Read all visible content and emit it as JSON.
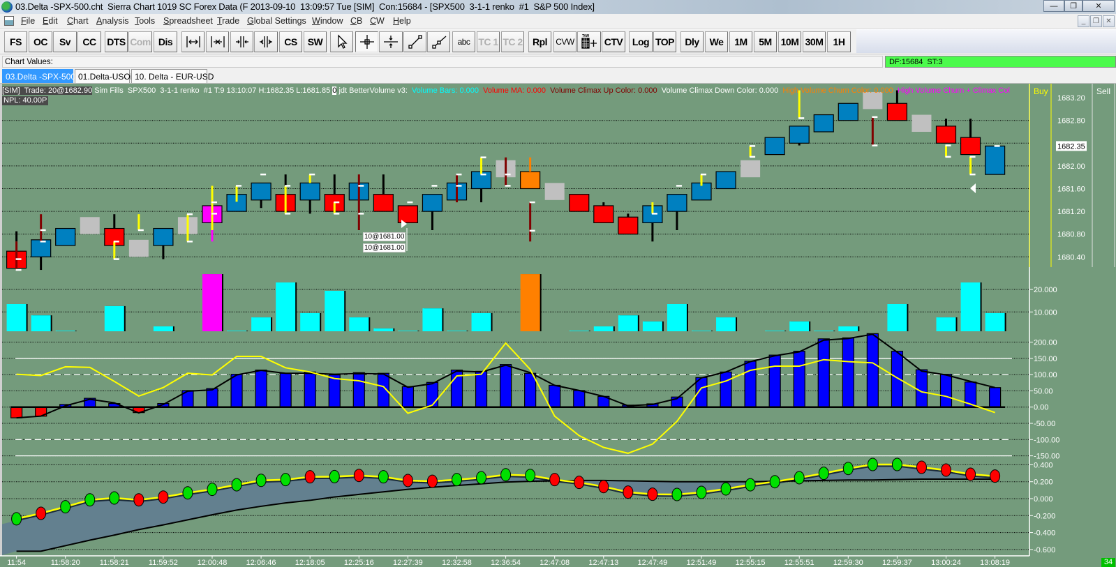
{
  "window": {
    "title": "03.Delta -SPX-500.cht  Sierra Chart 1019 SC Forex Data (F 2013-09-10  13:09:57 Tue [SIM]  Con:15684 - [SPX500  3-1-1 renko  #1  S&P 500 Index]",
    "controls": [
      "—",
      "❐",
      "✕"
    ],
    "mdi_controls": [
      "_",
      "❐",
      "✕"
    ]
  },
  "menu": [
    "File",
    "Edit",
    "Chart",
    "Analysis",
    "Tools",
    "Spreadsheet",
    "Trade",
    "Global Settings",
    "Window",
    "CB",
    "CW",
    "Help"
  ],
  "toolbar": [
    {
      "label": "FS"
    },
    {
      "label": "OC"
    },
    {
      "label": "Sv"
    },
    {
      "label": "CC"
    },
    {
      "label": "DTS"
    },
    {
      "label": "Com",
      "disabled": true
    },
    {
      "label": "Dis"
    },
    {
      "label": "",
      "icon": "scroll-expand-icon"
    },
    {
      "label": "",
      "icon": "scroll-compress-icon"
    },
    {
      "label": "",
      "icon": "zoom-in-icon"
    },
    {
      "label": "",
      "icon": "zoom-out-icon"
    },
    {
      "label": "CS"
    },
    {
      "label": "SW"
    },
    {
      "label": "",
      "icon": "pointer-icon"
    },
    {
      "label": "",
      "icon": "crosshair-icon",
      "pressed": true
    },
    {
      "label": "",
      "icon": "horizontal-line-icon"
    },
    {
      "label": "",
      "icon": "line-tool-icon"
    },
    {
      "label": "",
      "icon": "ray-tool-icon"
    },
    {
      "label": "abc",
      "small": true
    },
    {
      "label": "TC 1",
      "disabled": true
    },
    {
      "label": "TC 2",
      "disabled": true
    },
    {
      "label": "Rpl"
    },
    {
      "label": "CVW",
      "small": true
    },
    {
      "label": "",
      "icon": "tvw-grid-icon"
    },
    {
      "label": "CTV"
    },
    {
      "label": "Log"
    },
    {
      "label": "TOP"
    },
    {
      "label": "Dly"
    },
    {
      "label": "We"
    },
    {
      "label": "1M"
    },
    {
      "label": "5M"
    },
    {
      "label": "10M"
    },
    {
      "label": "30M"
    },
    {
      "label": "1H"
    }
  ],
  "chart_values_label": "Chart Values:",
  "status_box": "DF:15684  ST:3",
  "tabs": [
    {
      "label": "03.Delta -SPX-500",
      "active": true
    },
    {
      "label": "01.Delta-USOil",
      "active": false
    },
    {
      "label": "10. Delta - EUR-USD",
      "active": false
    }
  ],
  "info_line": [
    {
      "text": "[SIM]  Trade: 20@1682.90",
      "style": "dark"
    },
    {
      "text": " Sim Fills  SPX500  3-1-1 renko  #1 T:9 13:10:07 H:1682.35 L:1681.85 ",
      "color": "#ffffff"
    },
    {
      "text": "0",
      "style": "zero"
    },
    {
      "text": " jdt BetterVolume v3:  ",
      "color": "#ffffff"
    },
    {
      "text": "Volume Bars: 0.000  ",
      "color": "#00ffff"
    },
    {
      "text": "Volume MA: 0.000  ",
      "color": "#ff0000"
    },
    {
      "text": "Volume Climax Up Color: 0.000  ",
      "color": "#800000"
    },
    {
      "text": "Volume Climax Down Color: 0.000  ",
      "color": "#ffffff"
    },
    {
      "text": "High Volume Churn Color: 0.000  ",
      "color": "#ff8000"
    },
    {
      "text": "High Volume Churn + Climax Col",
      "color": "#ff00ff"
    }
  ],
  "npl": "NPL: 40.00P",
  "dom_headers": {
    "buy": "Buy",
    "sell": "Sell"
  },
  "order_labels": [
    "10@1681.00",
    "10@1681.00"
  ],
  "corner_badge": "34",
  "colors": {
    "background": "#749b7c",
    "blue": "#0080c0",
    "red": "#ff0000",
    "gray": "#c0c0c0",
    "magenta": "#ff00ff",
    "orange": "#ff8000",
    "black": "#000000",
    "darkred": "#800000",
    "yellow": "#ffff00",
    "cyan": "#00ffff",
    "osc_blue": "#0000ff",
    "band": "#63808f",
    "dot_up": "#00e000",
    "dot_down": "#ff0000"
  },
  "chart_data": {
    "type": "renko-candlestick",
    "symbol": "SPX500",
    "price_axis": {
      "labels": [
        "1683.20",
        "1682.80",
        "1682.00",
        "1681.60",
        "1681.20",
        "1680.80",
        "1680.40"
      ],
      "current_price": "1682.35"
    },
    "bars": [
      {
        "color": "red",
        "box": [
          1680.2,
          1680.5
        ],
        "wicks": [
          [
            1680.85,
            1680.67,
            "black"
          ],
          [
            1680.67,
            1680.18,
            "darkred"
          ]
        ],
        "marks": [
          1680.36,
          1680.17
        ]
      },
      {
        "color": "blue",
        "box": [
          1680.4,
          1680.7
        ],
        "wicks": [
          [
            1681.15,
            1680.67,
            "darkred"
          ],
          [
            1680.4,
            1680.17,
            "black"
          ]
        ],
        "marks": [
          1680.87,
          1680.67
        ]
      },
      {
        "color": "blue",
        "box": [
          1680.6,
          1680.9
        ],
        "wicks": [],
        "marks": []
      },
      {
        "color": "gray",
        "box": [
          1680.8,
          1681.1
        ],
        "wicks": [],
        "marks": []
      },
      {
        "color": "red",
        "box": [
          1680.6,
          1680.9
        ],
        "wicks": [
          [
            1681.15,
            1680.9,
            "black"
          ],
          [
            1680.67,
            1680.36,
            "yellow"
          ]
        ],
        "marks": [
          1680.67,
          1680.36
        ]
      },
      {
        "color": "gray",
        "box": [
          1680.4,
          1680.7
        ],
        "wicks": [
          [
            1681.15,
            1680.87,
            "yellow"
          ]
        ],
        "marks": [
          1680.87
        ]
      },
      {
        "color": "blue",
        "box": [
          1680.6,
          1680.9
        ],
        "wicks": [
          [
            1680.6,
            1680.36,
            "black"
          ]
        ],
        "marks": []
      },
      {
        "color": "gray",
        "box": [
          1680.8,
          1681.1
        ],
        "wicks": [
          [
            1681.15,
            1680.67,
            "yellow"
          ]
        ],
        "marks": [
          1681.15,
          1680.67
        ]
      },
      {
        "color": "magenta",
        "box": [
          1681.0,
          1681.3
        ],
        "wicks": [
          [
            1681.65,
            1680.87,
            "yellow"
          ],
          [
            1680.87,
            1680.67,
            "magenta"
          ]
        ],
        "marks": [
          1681.36,
          1681.16
        ]
      },
      {
        "color": "blue",
        "box": [
          1681.2,
          1681.5
        ],
        "wicks": [
          [
            1681.65,
            1681.37,
            "yellow"
          ]
        ],
        "marks": [
          1681.65
        ]
      },
      {
        "color": "blue",
        "box": [
          1681.4,
          1681.7
        ],
        "wicks": [
          [
            1681.4,
            1681.26,
            "black"
          ]
        ],
        "marks": [
          1681.85
        ]
      },
      {
        "color": "red",
        "box": [
          1681.2,
          1681.5
        ],
        "wicks": [
          [
            1681.85,
            1681.65,
            "black"
          ],
          [
            1681.65,
            1681.16,
            "yellow"
          ]
        ],
        "marks": [
          1681.65,
          1681.16
        ]
      },
      {
        "color": "blue",
        "box": [
          1681.4,
          1681.7
        ],
        "wicks": [
          [
            1681.85,
            1681.7,
            "yellow"
          ],
          [
            1681.4,
            1681.16,
            "black"
          ]
        ],
        "marks": [
          1681.85
        ]
      },
      {
        "color": "red",
        "box": [
          1681.2,
          1681.5
        ],
        "wicks": [
          [
            1681.85,
            1681.5,
            "black"
          ],
          [
            1681.36,
            1681.16,
            "yellow"
          ]
        ],
        "marks": [
          1681.36,
          1681.16
        ]
      },
      {
        "color": "blue",
        "box": [
          1681.4,
          1681.7
        ],
        "wicks": [
          [
            1681.85,
            1680.87,
            "darkred"
          ]
        ],
        "marks": [
          1681.65,
          1681.16
        ]
      },
      {
        "color": "red",
        "box": [
          1681.2,
          1681.5
        ],
        "wicks": [
          [
            1681.85,
            1681.5,
            "black"
          ]
        ],
        "marks": []
      },
      {
        "color": "red",
        "box": [
          1681.0,
          1681.3
        ],
        "wicks": [],
        "marks": [
          1681.36
        ]
      },
      {
        "color": "blue",
        "box": [
          1681.2,
          1681.5
        ],
        "wicks": [
          [
            1681.2,
            1680.87,
            "black"
          ]
        ],
        "marks": [
          1681.65
        ]
      },
      {
        "color": "blue",
        "box": [
          1681.4,
          1681.7
        ],
        "wicks": [
          [
            1681.85,
            1681.36,
            "darkred"
          ]
        ],
        "marks": [
          1681.85,
          1681.65
        ]
      },
      {
        "color": "blue",
        "box": [
          1681.6,
          1681.9
        ],
        "wicks": [
          [
            1682.15,
            1681.85,
            "yellow"
          ],
          [
            1681.6,
            1681.36,
            "black"
          ]
        ],
        "marks": [
          1682.15,
          1681.85
        ]
      },
      {
        "color": "gray",
        "box": [
          1681.8,
          1682.1
        ],
        "wicks": [
          [
            1682.15,
            1681.65,
            "darkred"
          ]
        ],
        "marks": [
          1681.85,
          1681.65
        ]
      },
      {
        "color": "orange",
        "box": [
          1681.6,
          1681.9
        ],
        "wicks": [
          [
            1682.15,
            1681.9,
            "orange"
          ],
          [
            1681.36,
            1680.67,
            "darkred"
          ]
        ],
        "marks": [
          1681.36,
          1680.86
        ]
      },
      {
        "color": "gray",
        "box": [
          1681.4,
          1681.7
        ],
        "wicks": [],
        "marks": []
      },
      {
        "color": "red",
        "box": [
          1681.2,
          1681.5
        ],
        "wicks": [],
        "marks": []
      },
      {
        "color": "red",
        "box": [
          1681.0,
          1681.3
        ],
        "wicks": [
          [
            1681.36,
            1681.3,
            "black"
          ]
        ],
        "marks": []
      },
      {
        "color": "red",
        "box": [
          1680.8,
          1681.1
        ],
        "wicks": [
          [
            1681.16,
            1681.1,
            "black"
          ]
        ],
        "marks": []
      },
      {
        "color": "blue",
        "box": [
          1681.0,
          1681.3
        ],
        "wicks": [
          [
            1681.36,
            1681.16,
            "yellow"
          ],
          [
            1681.0,
            1680.67,
            "black"
          ]
        ],
        "marks": [
          1681.16
        ]
      },
      {
        "color": "blue",
        "box": [
          1681.2,
          1681.5
        ],
        "wicks": [
          [
            1681.2,
            1680.87,
            "black"
          ]
        ],
        "marks": [
          1681.65
        ]
      },
      {
        "color": "blue",
        "box": [
          1681.4,
          1681.7
        ],
        "wicks": [
          [
            1681.85,
            1681.65,
            "yellow"
          ]
        ],
        "marks": [
          1681.85
        ]
      },
      {
        "color": "blue",
        "box": [
          1681.6,
          1681.9
        ],
        "wicks": [],
        "marks": []
      },
      {
        "color": "gray",
        "box": [
          1681.8,
          1682.1
        ],
        "wicks": [
          [
            1682.35,
            1682.16,
            "yellow"
          ]
        ],
        "marks": [
          1682.35,
          1682.16
        ]
      },
      {
        "color": "blue",
        "box": [
          1682.2,
          1682.5
        ],
        "wicks": [],
        "marks": []
      },
      {
        "color": "blue",
        "box": [
          1682.4,
          1682.7
        ],
        "wicks": [
          [
            1683.33,
            1682.84,
            "yellow"
          ],
          [
            1682.4,
            1682.36,
            "black"
          ]
        ],
        "marks": [
          1682.84
        ]
      },
      {
        "color": "blue",
        "box": [
          1682.6,
          1682.9
        ],
        "wicks": [],
        "marks": []
      },
      {
        "color": "blue",
        "box": [
          1682.8,
          1683.1
        ],
        "wicks": [],
        "marks": []
      },
      {
        "color": "gray",
        "box": [
          1683.0,
          1683.3
        ],
        "wicks": [
          [
            1682.86,
            1682.36,
            "darkred"
          ]
        ],
        "marks": [
          1682.86,
          1682.36
        ]
      },
      {
        "color": "red",
        "box": [
          1682.8,
          1683.1
        ],
        "wicks": [
          [
            1683.33,
            1683.1,
            "black"
          ]
        ],
        "marks": []
      },
      {
        "color": "gray",
        "box": [
          1682.6,
          1682.9
        ],
        "wicks": [],
        "marks": []
      },
      {
        "color": "red",
        "box": [
          1682.4,
          1682.7
        ],
        "wicks": [
          [
            1682.83,
            1682.7,
            "black"
          ],
          [
            1682.36,
            1682.16,
            "yellow"
          ]
        ],
        "marks": [
          1682.36,
          1682.16
        ]
      },
      {
        "color": "red",
        "box": [
          1682.2,
          1682.5
        ],
        "wicks": [
          [
            1682.83,
            1682.5,
            "black"
          ],
          [
            1682.16,
            1681.85,
            "yellow"
          ]
        ],
        "marks": [
          1682.16,
          1681.85
        ]
      },
      {
        "color": "blue",
        "box": [
          1681.85,
          1682.35
        ],
        "wicks": [],
        "marks": [
          1682.35
        ]
      }
    ],
    "volume": {
      "axis_labels": [
        "20.000",
        "10.000"
      ],
      "values": [
        13.5,
        8.5,
        1.7,
        0,
        12.6,
        0,
        3.6,
        0,
        26.8,
        1.7,
        7.6,
        23.1,
        9.5,
        19.4,
        7.6,
        2.7,
        1.7,
        11.6,
        1.7,
        9.5,
        0,
        26.8,
        0,
        1.7,
        3.6,
        8.5,
        5.8,
        13.5,
        1.7,
        7.6,
        0,
        1.7,
        5.8,
        1.7,
        3.6,
        0,
        13.5,
        0,
        7.6,
        23.1,
        9.5
      ],
      "highlight": {
        "8": "magenta",
        "21": "orange"
      }
    },
    "oscillator": {
      "axis_labels": [
        "200.00",
        "150.00",
        "100.00",
        "50.00",
        "0.00",
        "-50.00",
        "-100.00",
        "-150.00"
      ],
      "histogram": [
        -33,
        -28,
        8,
        27,
        11,
        -17,
        11,
        51,
        57,
        101,
        114,
        104,
        108,
        99,
        106,
        104,
        63,
        76,
        114,
        110,
        131,
        104,
        67,
        51,
        33,
        6,
        10,
        31,
        91,
        108,
        141,
        160,
        172,
        210,
        213,
        226,
        172,
        115,
        101,
        77,
        60
      ],
      "line_black": [
        -33,
        -28,
        4,
        24,
        13,
        -18,
        8,
        49,
        53,
        99,
        113,
        104,
        104,
        101,
        103,
        102,
        61,
        72,
        111,
        108,
        129,
        106,
        67,
        51,
        33,
        4,
        8,
        26,
        90,
        108,
        140,
        158,
        170,
        206,
        211,
        224,
        169,
        111,
        99,
        79,
        60
      ],
      "line_yellow": [
        101,
        97,
        124,
        122,
        79,
        34,
        60,
        104,
        99,
        156,
        156,
        121,
        108,
        88,
        81,
        63,
        -19,
        6,
        96,
        101,
        197,
        116,
        -28,
        -88,
        -124,
        -142,
        -114,
        -44,
        59,
        80,
        113,
        126,
        126,
        146,
        140,
        136,
        90,
        47,
        33,
        9,
        -17
      ]
    },
    "lower_indicator": {
      "axis_labels": [
        "0.400",
        "0.200",
        "0.000",
        "-0.200",
        "-0.400",
        "-0.600"
      ],
      "dots": [
        -0.238,
        -0.173,
        -0.096,
        -0.014,
        0.008,
        -0.014,
        0.019,
        0.068,
        0.11,
        0.164,
        0.216,
        0.225,
        0.258,
        0.26,
        0.274,
        0.258,
        0.214,
        0.205,
        0.225,
        0.247,
        0.282,
        0.274,
        0.225,
        0.192,
        0.142,
        0.077,
        0.052,
        0.049,
        0.074,
        0.115,
        0.164,
        0.2,
        0.247,
        0.299,
        0.356,
        0.403,
        0.403,
        0.37,
        0.337,
        0.288,
        0.266
      ],
      "dot_up": [
        1,
        0,
        1,
        1,
        1,
        0,
        0,
        1,
        1,
        1,
        1,
        1,
        0,
        1,
        0,
        1,
        0,
        0,
        1,
        1,
        1,
        1,
        0,
        0,
        0,
        0,
        0,
        1,
        1,
        1,
        1,
        1,
        1,
        1,
        1,
        1,
        1,
        0,
        0,
        0,
        0
      ],
      "slow": [
        -0.62,
        -0.62,
        -0.555,
        -0.49,
        -0.43,
        -0.365,
        -0.31,
        -0.25,
        -0.19,
        -0.135,
        -0.09,
        -0.05,
        -0.02,
        0.02,
        0.05,
        0.08,
        0.11,
        0.135,
        0.155,
        0.175,
        0.195,
        0.205,
        0.21,
        0.215,
        0.215,
        0.21,
        0.205,
        0.2,
        0.2,
        0.2,
        0.2,
        0.205,
        0.21,
        0.215,
        0.22,
        0.22,
        0.225,
        0.23,
        0.23,
        0.23,
        0.23
      ]
    },
    "time_labels": [
      "11:54",
      "11:58:20",
      "11:58:21",
      "11:59:52",
      "12:00:48",
      "12:06:46",
      "12:18:05",
      "12:25:16",
      "12:27:39",
      "12:32:58",
      "12:36:54",
      "12:47:08",
      "12:47:13",
      "12:47:49",
      "12:51:49",
      "12:55:15",
      "12:55:51",
      "12:59:30",
      "12:59:37",
      "13:00:24",
      "13:08:19"
    ]
  }
}
